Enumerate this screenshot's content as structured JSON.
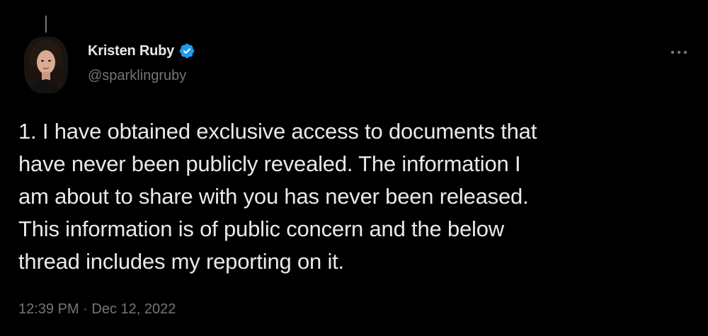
{
  "tweet": {
    "author": {
      "display_name": "Kristen Ruby",
      "handle": "@sparklingruby",
      "verified": true,
      "verified_icon": "verified-badge-icon",
      "avatar_icon": "avatar"
    },
    "more_icon": "more-options-icon",
    "text_lines": [
      "1. I have obtained exclusive access to documents that",
      "have never been publicly revealed. The information I",
      "am about to share with you has never been released.",
      "This information is of public concern and the below",
      "thread includes my reporting on it."
    ],
    "timestamp": "12:39 PM · Dec 12, 2022"
  },
  "colors": {
    "background": "#000000",
    "text_primary": "#e7e9ea",
    "text_secondary": "#71767b",
    "verified_blue": "#1d9bf0"
  }
}
